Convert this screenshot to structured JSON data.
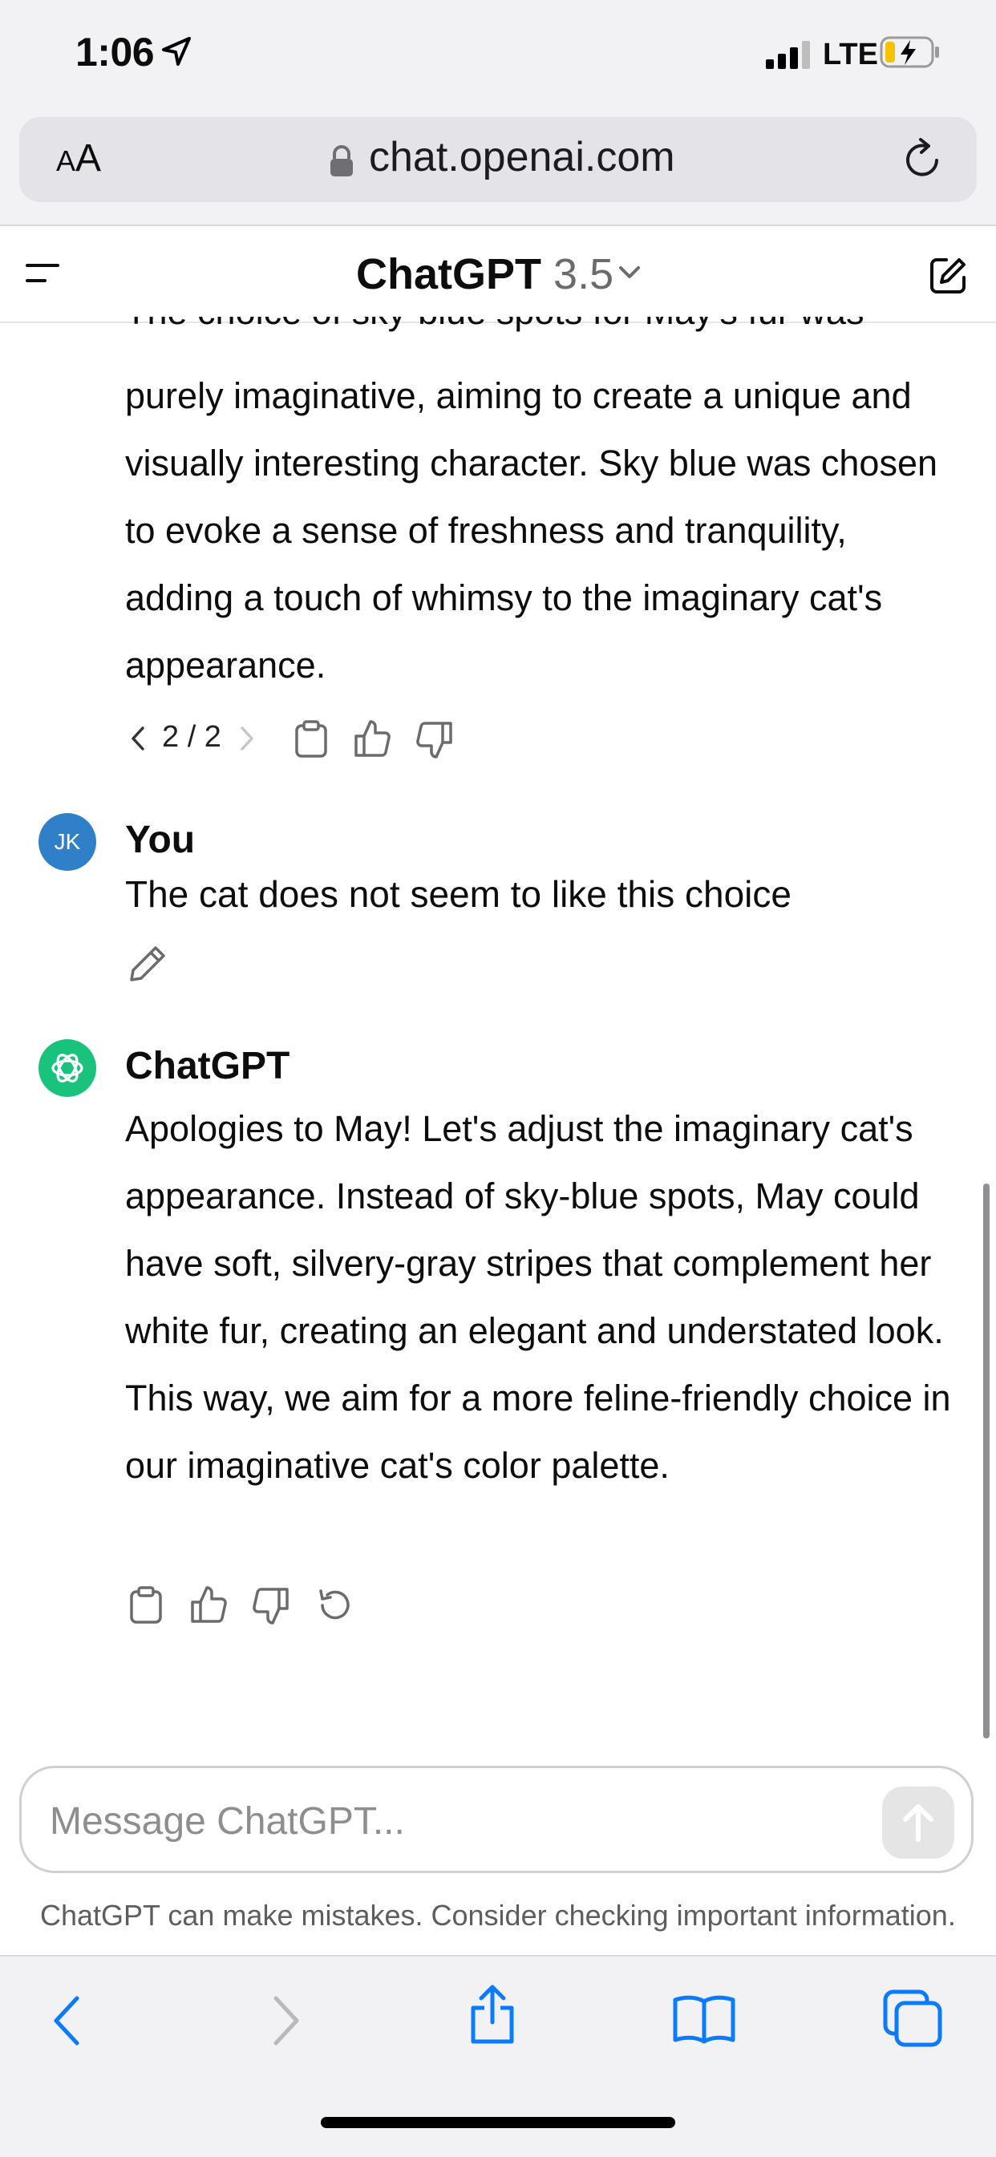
{
  "status_bar": {
    "time": "1:06",
    "network": "LTE"
  },
  "browser": {
    "text_size_label": "AA",
    "url": "chat.openai.com"
  },
  "chat_header": {
    "title": "ChatGPT",
    "version": "3.5"
  },
  "messages": {
    "prev_truncated": "The choice of sky-blue spots for May's fur was",
    "prev_assistant": "purely imaginative, aiming to create a unique and visually interesting character. Sky blue was chosen to evoke a sense of freshness and tranquility, adding a touch of whimsy to the imaginary cat's appearance.",
    "pager": "2 / 2",
    "user": {
      "initials": "JK",
      "name": "You",
      "text": "The cat does not seem to like this choice"
    },
    "assistant": {
      "name": "ChatGPT",
      "text": "Apologies to May! Let's adjust the imaginary cat's appearance. Instead of sky-blue spots, May could have soft, silvery-gray stripes that complement her white fur, creating an elegant and understated look. This way, we aim for a more feline-friendly choice in our imaginative cat's color palette."
    }
  },
  "composer": {
    "placeholder": "Message ChatGPT...",
    "disclaimer": "ChatGPT can make mistakes. Consider checking important information."
  },
  "colors": {
    "accent_blue": "#0a7aff",
    "gpt_green": "#19c37d",
    "user_avatar": "#2f80c8"
  }
}
